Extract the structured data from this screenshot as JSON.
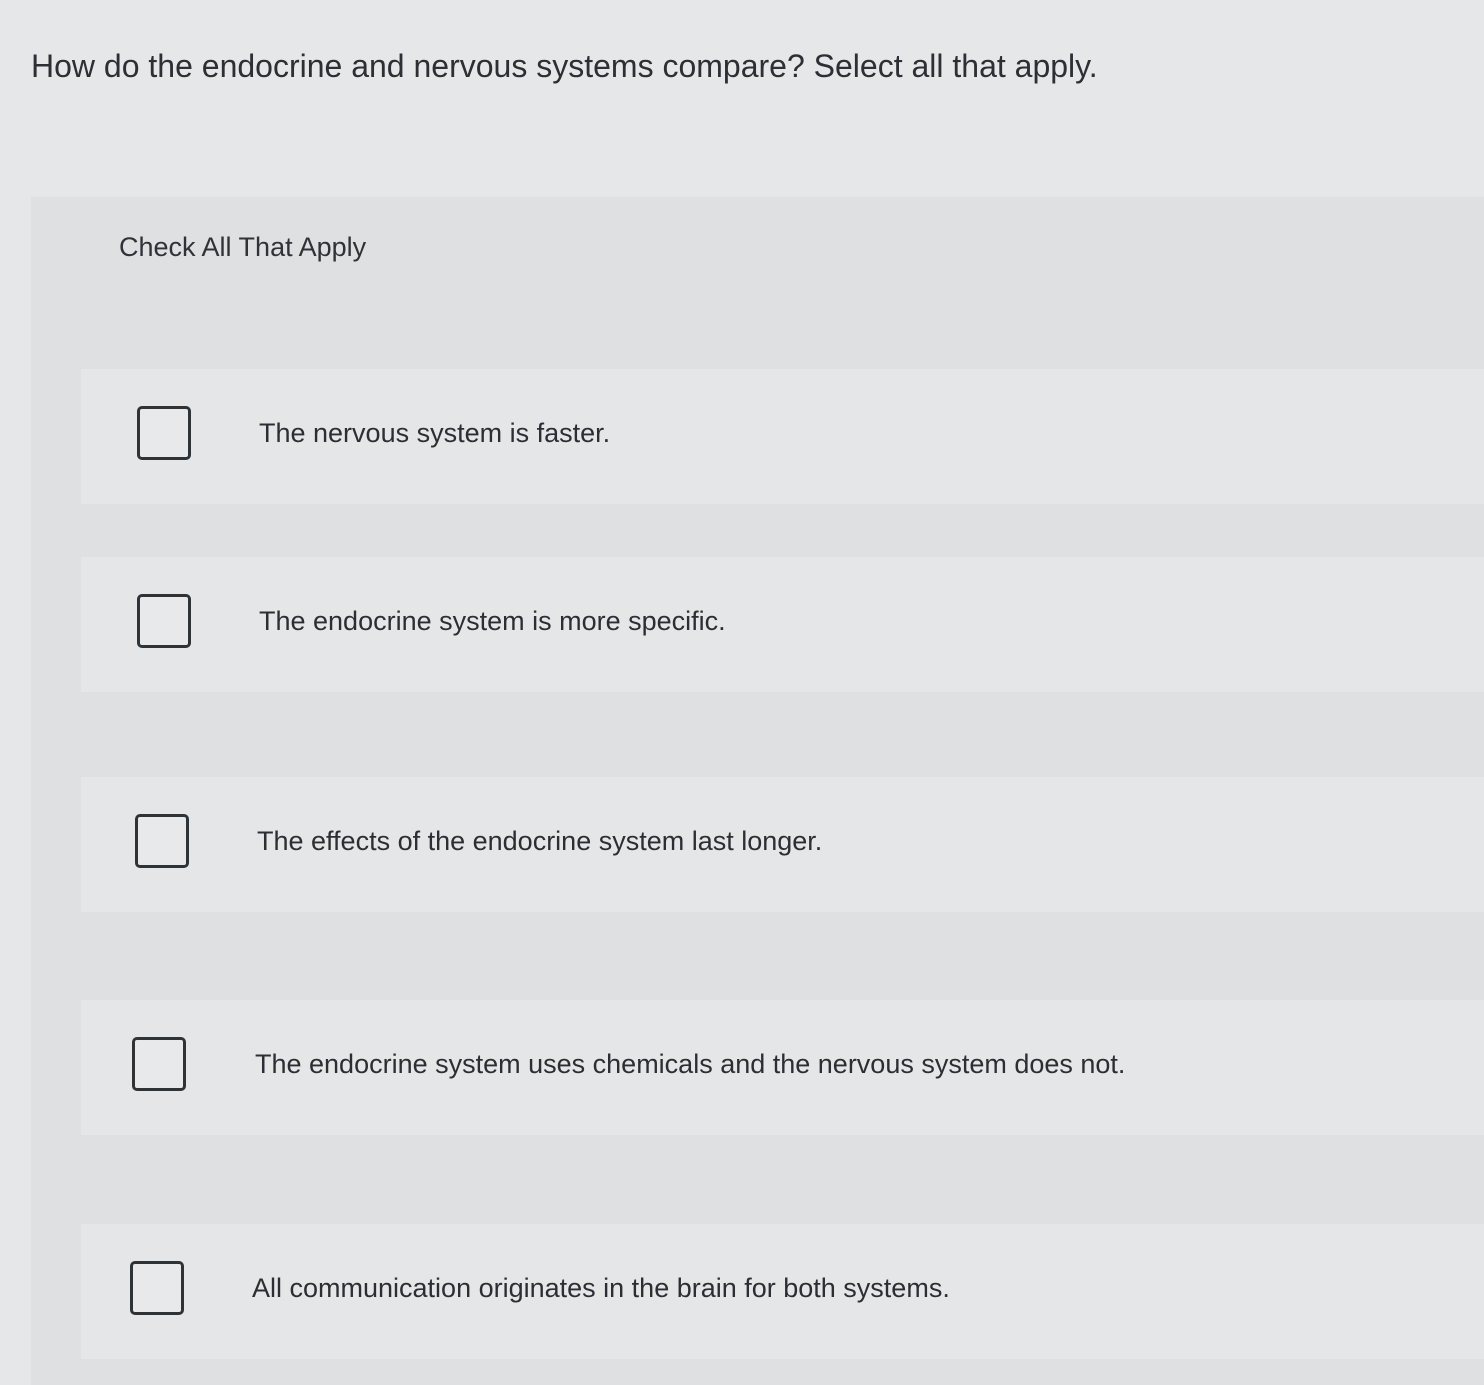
{
  "question": {
    "text": "How do the endocrine and nervous systems compare? Select all that apply."
  },
  "panel": {
    "header": "Check All That Apply",
    "options": [
      {
        "label": "The nervous system is faster.",
        "checked": false
      },
      {
        "label": "The endocrine system is more specific.",
        "checked": false
      },
      {
        "label": "The effects of the endocrine system last longer.",
        "checked": false
      },
      {
        "label": "The endocrine system uses chemicals and the nervous system does not.",
        "checked": false
      },
      {
        "label": "All communication originates in the brain for both systems.",
        "checked": false
      }
    ]
  }
}
